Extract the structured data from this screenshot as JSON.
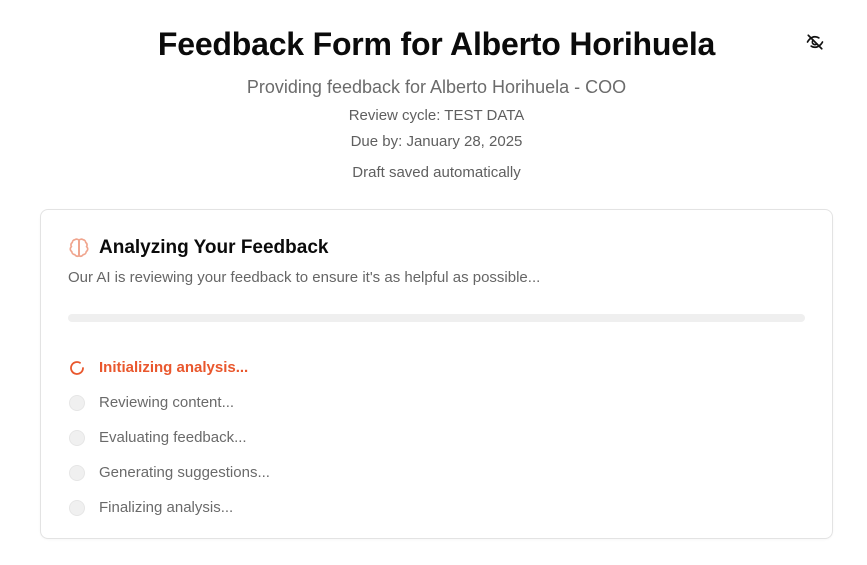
{
  "header": {
    "title": "Feedback Form for Alberto Horihuela",
    "subtitle": "Providing feedback for Alberto Horihuela - COO",
    "review_cycle": "Review cycle: TEST DATA",
    "due_by": "Due by: January 28, 2025",
    "draft_status": "Draft saved automatically",
    "toggle_icon": "eye-off-icon"
  },
  "analysis": {
    "icon": "brain-icon",
    "title": "Analyzing Your Feedback",
    "description": "Our AI is reviewing your feedback to ensure it's as helpful as possible...",
    "progress": 0,
    "accent_color": "#e9572d",
    "steps": [
      {
        "label": "Initializing analysis...",
        "status": "active",
        "icon": "spinner-icon"
      },
      {
        "label": "Reviewing content...",
        "status": "pending",
        "icon": "circle-icon"
      },
      {
        "label": "Evaluating feedback...",
        "status": "pending",
        "icon": "circle-icon"
      },
      {
        "label": "Generating suggestions...",
        "status": "pending",
        "icon": "circle-icon"
      },
      {
        "label": "Finalizing analysis...",
        "status": "pending",
        "icon": "circle-icon"
      }
    ]
  }
}
